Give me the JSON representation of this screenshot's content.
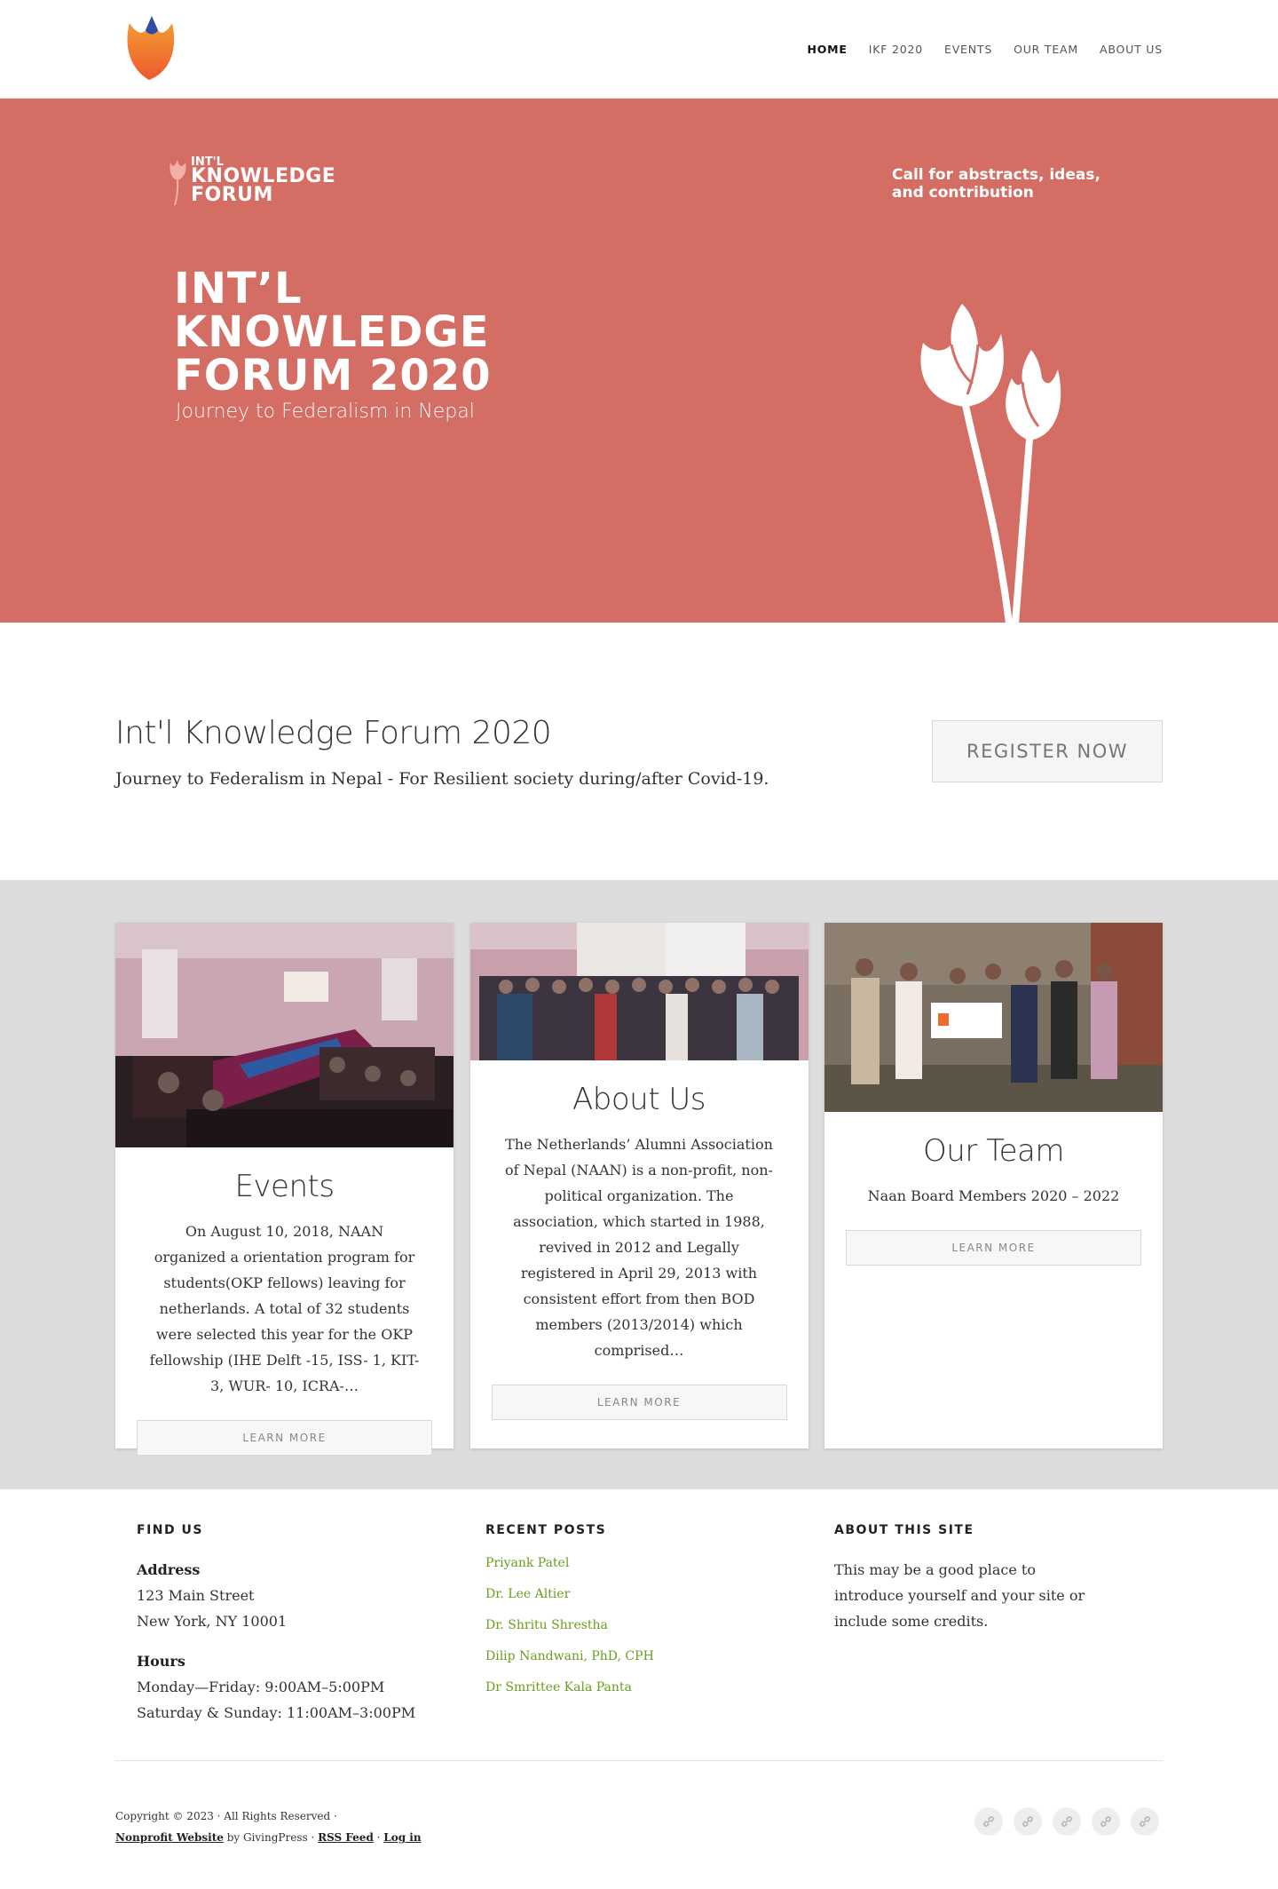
{
  "nav": {
    "items": [
      {
        "label": "HOME",
        "active": true
      },
      {
        "label": "IKF 2020",
        "active": false
      },
      {
        "label": "EVENTS",
        "active": false
      },
      {
        "label": "OUR TEAM",
        "active": false
      },
      {
        "label": "ABOUT US",
        "active": false
      }
    ]
  },
  "hero": {
    "brand_line1": "INT'L",
    "brand_line2": "KNOWLEDGE",
    "brand_line3": "FORUM",
    "title_line1": "INT’L",
    "title_line2": "KNOWLEDGE",
    "title_line3": "FORUM 2020",
    "subtitle": "Journey to Federalism in Nepal",
    "call": "Call for abstracts, ideas, and contribution",
    "background_color": "#d46e65"
  },
  "intro": {
    "title": "Int'l Knowledge Forum 2020",
    "text": "Journey to Federalism in Nepal - For Resilient society during/after Covid-19.",
    "button": "REGISTER NOW"
  },
  "cards": [
    {
      "title": "Events",
      "text": "On August 10, 2018, NAAN organized a orientation program for students(OKP fellows) leaving for netherlands. A total of 32 students were selected this year for the OKP fellowship (IHE Delft -15, ISS- 1, KIT-3, WUR- 10, ICRA-…",
      "button": "LEARN MORE"
    },
    {
      "title": "About Us",
      "text": "The Netherlands’ Alumni Association of Nepal (NAAN) is a non-profit, non-political organization. The association, which started in 1988, revived in 2012 and Legally registered in April 29, 2013 with consistent effort from then BOD members (2013/2014) which comprised…",
      "button": "LEARN MORE"
    },
    {
      "title": "Our Team",
      "text": "Naan Board Members 2020 – 2022",
      "button": "LEARN MORE"
    }
  ],
  "footer": {
    "find_us": {
      "heading": "FIND US",
      "address_label": "Address",
      "address_line1": "123 Main Street",
      "address_line2": "New York, NY 10001",
      "hours_label": "Hours",
      "hours_line1": "Monday—Friday: 9:00AM–5:00PM",
      "hours_line2": "Saturday & Sunday: 11:00AM–3:00PM"
    },
    "recent_posts": {
      "heading": "RECENT POSTS",
      "posts": [
        "Priyank Patel",
        "Dr. Lee Altier",
        "Dr. Shritu Shrestha",
        "Dilip Nandwani, PhD, CPH",
        "Dr Smrittee Kala Panta"
      ]
    },
    "about_site": {
      "heading": "ABOUT THIS SITE",
      "text": "This may be a good place to introduce yourself and your site or include some credits."
    },
    "copyright": "Copyright © 2023 · All Rights Reserved ·",
    "link_nonprofit": "Nonprofit Website",
    "by_text": " by GivingPress · ",
    "link_rss": "RSS Feed",
    "sep": " · ",
    "link_login": "Log in",
    "social_icons": [
      "link-icon",
      "link-icon",
      "link-icon",
      "link-icon",
      "link-icon"
    ]
  }
}
